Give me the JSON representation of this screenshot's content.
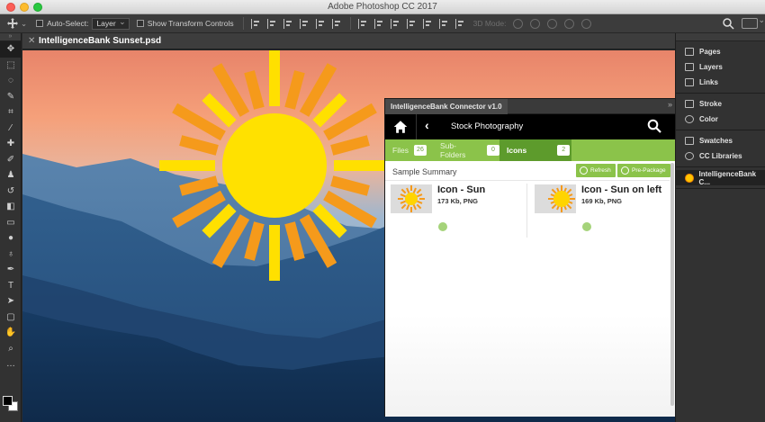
{
  "window": {
    "app_title": "Adobe Photoshop CC 2017"
  },
  "options_bar": {
    "auto_select_label": "Auto-Select:",
    "auto_select_value": "Layer",
    "show_transform_label": "Show Transform Controls",
    "mode_label": "3D Mode:"
  },
  "document": {
    "tab_title": "IntelligenceBank Sunset.psd"
  },
  "connector": {
    "panel_title": "IntelligenceBank Connector v1.0",
    "nav_title": "Stock Photography",
    "tabs": [
      {
        "label": "Files",
        "count": "26"
      },
      {
        "label": "Sub-Folders",
        "count": "0"
      },
      {
        "label": "Icons",
        "count": "2"
      }
    ],
    "summary_label": "Sample Summary",
    "refresh_label": "Refresh",
    "prepackage_label": "Pre-Package",
    "assets": [
      {
        "title": "Icon - Sun",
        "meta": "173 Kb, PNG"
      },
      {
        "title": "Icon - Sun on left",
        "meta": "169 Kb, PNG"
      }
    ]
  },
  "dock": {
    "groups": [
      [
        "Pages",
        "Layers",
        "Links"
      ],
      [
        "Stroke",
        "Color"
      ],
      [
        "Swatches",
        "CC Libraries"
      ]
    ],
    "active_panel": "IntelligenceBank C..."
  },
  "colors": {
    "accent_green": "#8bc34a",
    "active_tab_green": "#5d9b2c",
    "sun_yellow": "#ffe000",
    "sun_orange": "#f59a1b"
  }
}
